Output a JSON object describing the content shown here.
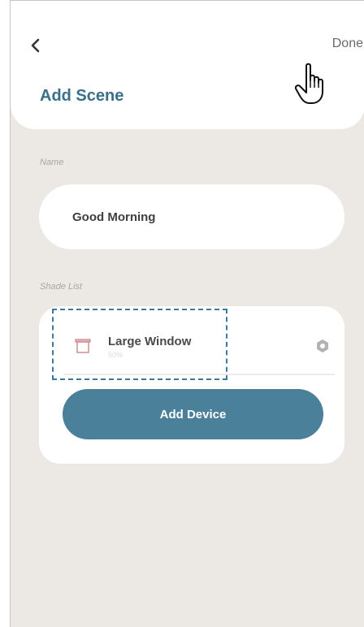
{
  "header": {
    "back_icon": "chevron-left-icon",
    "done_label": "Done",
    "title": "Add Scene",
    "cursor_icon": "hand-pointer-icon"
  },
  "name_section": {
    "label": "Name",
    "value": "Good Morning"
  },
  "shade_list": {
    "label": "Shade List",
    "devices": [
      {
        "name": "Large Window",
        "status": "50%",
        "icon": "window-shade-icon",
        "action_icon": "gear-icon"
      }
    ],
    "add_device_label": "Add Device"
  },
  "colors": {
    "background": "#ece8e3",
    "card": "#ffffff",
    "title": "#3a6f89",
    "accent_button": "#4a8099",
    "highlight_dash": "#3a7a9a"
  }
}
